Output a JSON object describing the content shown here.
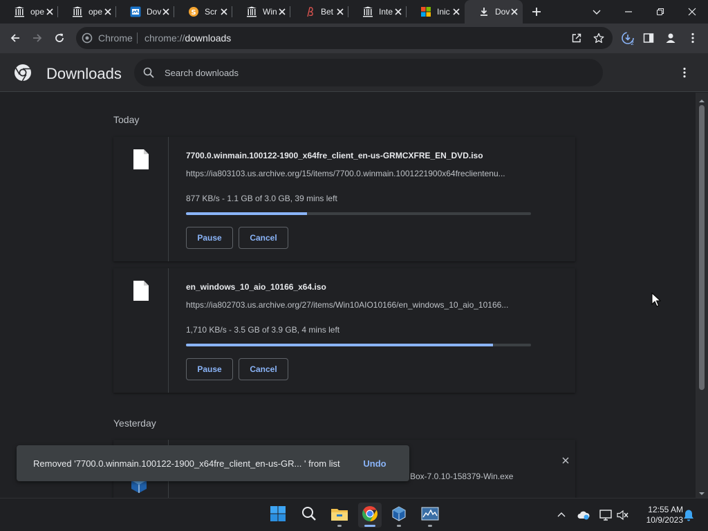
{
  "browser": {
    "tabs": [
      {
        "title": "ope",
        "icon": "archive-columns-icon",
        "active": false
      },
      {
        "title": "ope",
        "icon": "archive-columns-icon",
        "active": false
      },
      {
        "title": "Dov",
        "icon": "dow-site-icon",
        "active": false
      },
      {
        "title": "Scr",
        "icon": "scratch-coin-icon",
        "active": false
      },
      {
        "title": "Win",
        "icon": "archive-columns-icon",
        "active": false
      },
      {
        "title": "Bet",
        "icon": "beta-site-icon",
        "active": false
      },
      {
        "title": "Inte",
        "icon": "archive-columns-icon",
        "active": false
      },
      {
        "title": "Inic",
        "icon": "windows-logo-icon",
        "active": false
      },
      {
        "title": "Dov",
        "icon": "download-icon",
        "active": true
      }
    ],
    "omnibox": {
      "scheme": "Chrome",
      "url_prefix": "chrome://",
      "url_host": "downloads"
    },
    "downloads_badge": "2"
  },
  "page": {
    "title": "Downloads",
    "search_placeholder": "Search downloads",
    "sections": {
      "today": "Today",
      "yesterday": "Yesterday"
    },
    "downloads": [
      {
        "filename": "7700.0.winmain.100122-1900_x64fre_client_en-us-GRMCXFRE_EN_DVD.iso",
        "url": "https://ia803103.us.archive.org/15/items/7700.0.winmain.1001221900x64freclientenu...",
        "status": "877 KB/s - 1.1 GB of 3.0 GB, 39 mins left",
        "progress": 0.35,
        "pause_label": "Pause",
        "cancel_label": "Cancel"
      },
      {
        "filename": "en_windows_10_aio_10166_x64.iso",
        "url": "https://ia802703.us.archive.org/27/items/Win10AIO10166/en_windows_10_aio_10166...",
        "status": "1,710 KB/s - 3.5 GB of 3.9 GB, 4 mins left",
        "progress": 0.89,
        "pause_label": "Pause",
        "cancel_label": "Cancel"
      }
    ],
    "yesterday_item_partial": "Box-7.0.10-158379-Win.exe"
  },
  "toast": {
    "message": "Removed '7700.0.winmain.100122-1900_x64fre_client_en-us-GR...  ' from list",
    "undo_label": "Undo"
  },
  "taskbar": {
    "apps": [
      "windows-start-icon",
      "search-icon",
      "file-explorer-icon",
      "chrome-icon",
      "virtualbox-icon",
      "task-manager-icon"
    ],
    "time": "12:55 AM",
    "date": "10/9/2023"
  },
  "colors": {
    "accent": "#8ab4f8",
    "background": "#202124",
    "header": "#292a2d"
  }
}
